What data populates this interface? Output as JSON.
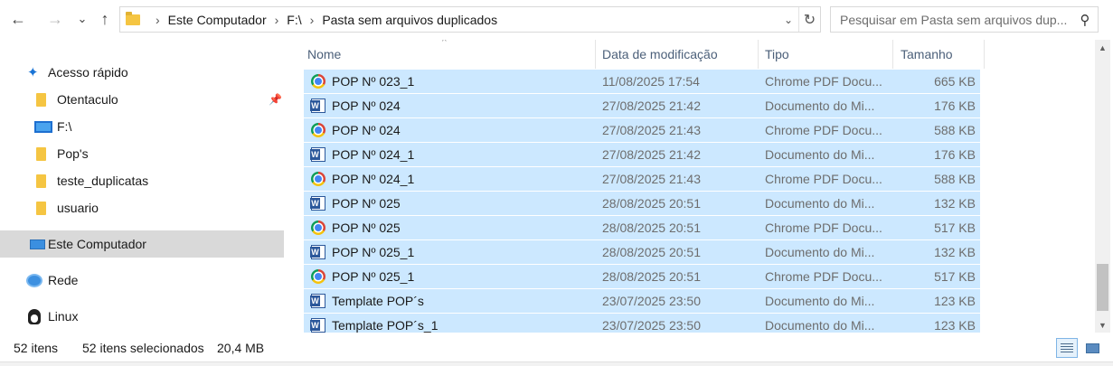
{
  "nav_buttons": {
    "back": "←",
    "forward": "→",
    "recent": "⌄",
    "up": "↑"
  },
  "breadcrumb": [
    "Este Computador",
    "F:\\",
    "Pasta sem arquivos duplicados"
  ],
  "search": {
    "placeholder": "Pesquisar em Pasta sem arquivos dup..."
  },
  "sidebar": {
    "items": [
      {
        "label": "Acesso rápido",
        "icon": "star-icon"
      },
      {
        "label": "Otentaculo",
        "icon": "folder-icon",
        "pinned": true
      },
      {
        "label": "F:\\",
        "icon": "drive-icon"
      },
      {
        "label": "Pop's",
        "icon": "folder-icon"
      },
      {
        "label": "teste_duplicatas",
        "icon": "folder-icon"
      },
      {
        "label": "usuario",
        "icon": "folder-icon"
      },
      {
        "label": "Este Computador",
        "icon": "computer-icon",
        "selected": true
      },
      {
        "label": "Rede",
        "icon": "network-icon"
      },
      {
        "label": "Linux",
        "icon": "linux-icon"
      }
    ]
  },
  "columns": {
    "name": "Nome",
    "date": "Data de modificação",
    "type": "Tipo",
    "size": "Tamanho"
  },
  "files": [
    {
      "name": "POP Nº 023_1",
      "date": "11/08/2025 17:54",
      "type": "Chrome PDF Docu...",
      "size": "665 KB",
      "icon": "chrome-pdf-icon"
    },
    {
      "name": "POP Nº 024",
      "date": "27/08/2025 21:42",
      "type": "Documento do Mi...",
      "size": "176 KB",
      "icon": "word-doc-icon"
    },
    {
      "name": "POP Nº 024",
      "date": "27/08/2025 21:43",
      "type": "Chrome PDF Docu...",
      "size": "588 KB",
      "icon": "chrome-pdf-icon"
    },
    {
      "name": "POP Nº 024_1",
      "date": "27/08/2025 21:42",
      "type": "Documento do Mi...",
      "size": "176 KB",
      "icon": "word-doc-icon"
    },
    {
      "name": "POP Nº 024_1",
      "date": "27/08/2025 21:43",
      "type": "Chrome PDF Docu...",
      "size": "588 KB",
      "icon": "chrome-pdf-icon"
    },
    {
      "name": "POP Nº 025",
      "date": "28/08/2025 20:51",
      "type": "Documento do Mi...",
      "size": "132 KB",
      "icon": "word-doc-icon"
    },
    {
      "name": "POP Nº 025",
      "date": "28/08/2025 20:51",
      "type": "Chrome PDF Docu...",
      "size": "517 KB",
      "icon": "chrome-pdf-icon"
    },
    {
      "name": "POP Nº 025_1",
      "date": "28/08/2025 20:51",
      "type": "Documento do Mi...",
      "size": "132 KB",
      "icon": "word-doc-icon"
    },
    {
      "name": "POP Nº 025_1",
      "date": "28/08/2025 20:51",
      "type": "Chrome PDF Docu...",
      "size": "517 KB",
      "icon": "chrome-pdf-icon"
    },
    {
      "name": "Template POP´s",
      "date": "23/07/2025 23:50",
      "type": "Documento do Mi...",
      "size": "123 KB",
      "icon": "word-doc-icon"
    },
    {
      "name": "Template POP´s_1",
      "date": "23/07/2025 23:50",
      "type": "Documento do Mi...",
      "size": "123 KB",
      "icon": "word-doc-icon"
    }
  ],
  "status": {
    "item_count": "52 itens",
    "selected": "52 itens selecionados",
    "selected_size": "20,4 MB"
  },
  "colors": {
    "selection": "#cce8ff",
    "accent": "#1a74d6"
  }
}
